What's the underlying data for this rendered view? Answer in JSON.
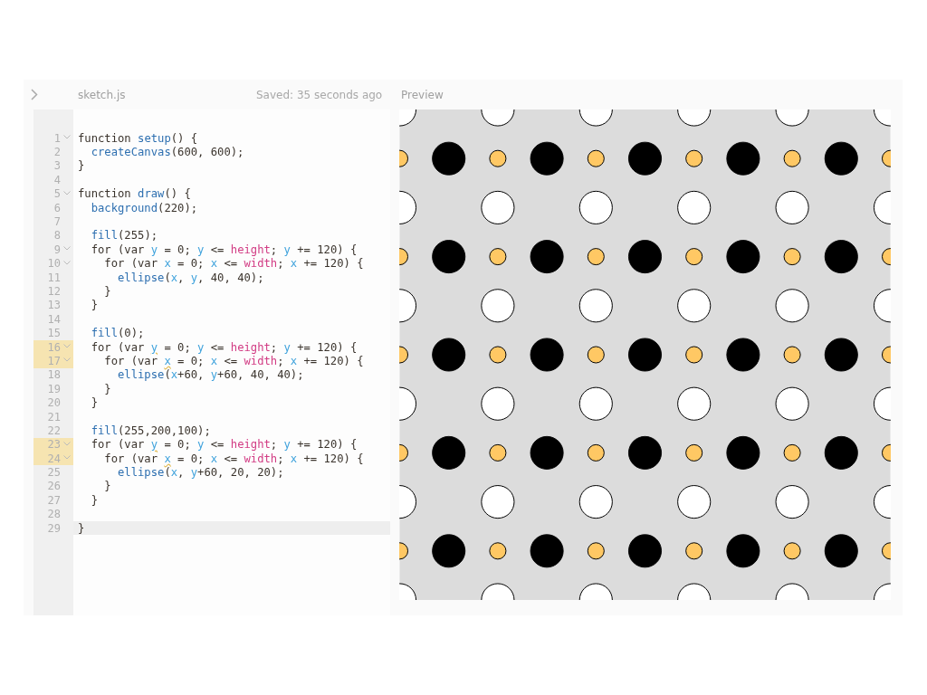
{
  "header": {
    "filename": "sketch.js",
    "save_status": "Saved: 35 seconds ago",
    "preview_label": "Preview"
  },
  "editor": {
    "lines": [
      {
        "number": "1",
        "foldable": true,
        "marked": false,
        "active": false,
        "tokens": [
          {
            "text": "function ",
            "kind": "plain"
          },
          {
            "text": "setup",
            "kind": "func"
          },
          {
            "text": "() {",
            "kind": "plain"
          }
        ]
      },
      {
        "number": "2",
        "foldable": false,
        "marked": false,
        "active": false,
        "tokens": [
          {
            "text": "  createCanvas",
            "kind": "func"
          },
          {
            "text": "(600, 600);",
            "kind": "plain"
          }
        ]
      },
      {
        "number": "3",
        "foldable": false,
        "marked": false,
        "active": false,
        "tokens": [
          {
            "text": "}",
            "kind": "plain"
          }
        ]
      },
      {
        "number": "4",
        "foldable": false,
        "marked": false,
        "active": false
      },
      {
        "number": "5",
        "foldable": true,
        "marked": false,
        "active": false,
        "tokens": [
          {
            "text": "function ",
            "kind": "plain"
          },
          {
            "text": "draw",
            "kind": "func"
          },
          {
            "text": "() {",
            "kind": "plain"
          }
        ]
      },
      {
        "number": "6",
        "foldable": false,
        "marked": false,
        "active": false,
        "tokens": [
          {
            "text": "  background",
            "kind": "func"
          },
          {
            "text": "(220);",
            "kind": "plain"
          }
        ]
      },
      {
        "number": "7",
        "foldable": false,
        "marked": false,
        "active": false
      },
      {
        "number": "8",
        "foldable": false,
        "marked": false,
        "active": false,
        "tokens": [
          {
            "text": "  fill",
            "kind": "func"
          },
          {
            "text": "(255);",
            "kind": "plain"
          }
        ]
      },
      {
        "number": "9",
        "foldable": true,
        "marked": false,
        "active": false,
        "tokens": [
          {
            "text": "  for (var ",
            "kind": "plain"
          },
          {
            "text": "y",
            "kind": "var"
          },
          {
            "text": " = 0; ",
            "kind": "plain"
          },
          {
            "text": "y",
            "kind": "var"
          },
          {
            "text": " <= ",
            "kind": "plain"
          },
          {
            "text": "height",
            "kind": "builtin"
          },
          {
            "text": "; ",
            "kind": "plain"
          },
          {
            "text": "y",
            "kind": "var"
          },
          {
            "text": " += 120) {",
            "kind": "plain"
          }
        ]
      },
      {
        "number": "10",
        "foldable": true,
        "marked": false,
        "active": false,
        "tokens": [
          {
            "text": "    for (var ",
            "kind": "plain"
          },
          {
            "text": "x",
            "kind": "var"
          },
          {
            "text": " = 0; ",
            "kind": "plain"
          },
          {
            "text": "x",
            "kind": "var"
          },
          {
            "text": " <= ",
            "kind": "plain"
          },
          {
            "text": "width",
            "kind": "builtin"
          },
          {
            "text": "; ",
            "kind": "plain"
          },
          {
            "text": "x",
            "kind": "var"
          },
          {
            "text": " += 120) {",
            "kind": "plain"
          }
        ]
      },
      {
        "number": "11",
        "foldable": false,
        "marked": false,
        "active": false,
        "tokens": [
          {
            "text": "      ellipse",
            "kind": "func"
          },
          {
            "text": "(",
            "kind": "plain"
          },
          {
            "text": "x",
            "kind": "var"
          },
          {
            "text": ", ",
            "kind": "plain"
          },
          {
            "text": "y",
            "kind": "var"
          },
          {
            "text": ", 40, 40);",
            "kind": "plain"
          }
        ]
      },
      {
        "number": "12",
        "foldable": false,
        "marked": false,
        "active": false,
        "tokens": [
          {
            "text": "    }",
            "kind": "plain"
          }
        ]
      },
      {
        "number": "13",
        "foldable": false,
        "marked": false,
        "active": false,
        "tokens": [
          {
            "text": "  }",
            "kind": "plain"
          }
        ]
      },
      {
        "number": "14",
        "foldable": false,
        "marked": false,
        "active": false
      },
      {
        "number": "15",
        "foldable": false,
        "marked": false,
        "active": false,
        "tokens": [
          {
            "text": "  fill",
            "kind": "func"
          },
          {
            "text": "(0);",
            "kind": "plain"
          }
        ]
      },
      {
        "number": "16",
        "foldable": true,
        "marked": true,
        "active": false,
        "tokens": [
          {
            "text": "  for (var ",
            "kind": "plain"
          },
          {
            "text": "y",
            "kind": "warn"
          },
          {
            "text": " = 0; ",
            "kind": "plain"
          },
          {
            "text": "y",
            "kind": "var"
          },
          {
            "text": " <= ",
            "kind": "plain"
          },
          {
            "text": "height",
            "kind": "builtin"
          },
          {
            "text": "; ",
            "kind": "plain"
          },
          {
            "text": "y",
            "kind": "var"
          },
          {
            "text": " += 120) {",
            "kind": "plain"
          }
        ]
      },
      {
        "number": "17",
        "foldable": true,
        "marked": true,
        "active": false,
        "tokens": [
          {
            "text": "    for (var ",
            "kind": "plain"
          },
          {
            "text": "x",
            "kind": "warn"
          },
          {
            "text": " = 0; ",
            "kind": "plain"
          },
          {
            "text": "x",
            "kind": "var"
          },
          {
            "text": " <= ",
            "kind": "plain"
          },
          {
            "text": "width",
            "kind": "builtin"
          },
          {
            "text": "; ",
            "kind": "plain"
          },
          {
            "text": "x",
            "kind": "var"
          },
          {
            "text": " += 120) {",
            "kind": "plain"
          }
        ]
      },
      {
        "number": "18",
        "foldable": false,
        "marked": false,
        "active": false,
        "tokens": [
          {
            "text": "      ellipse",
            "kind": "func"
          },
          {
            "text": "(",
            "kind": "plain"
          },
          {
            "text": "x",
            "kind": "var"
          },
          {
            "text": "+60, ",
            "kind": "plain"
          },
          {
            "text": "y",
            "kind": "var"
          },
          {
            "text": "+60, 40, 40);",
            "kind": "plain"
          }
        ]
      },
      {
        "number": "19",
        "foldable": false,
        "marked": false,
        "active": false,
        "tokens": [
          {
            "text": "    }",
            "kind": "plain"
          }
        ]
      },
      {
        "number": "20",
        "foldable": false,
        "marked": false,
        "active": false,
        "tokens": [
          {
            "text": "  }",
            "kind": "plain"
          }
        ]
      },
      {
        "number": "21",
        "foldable": false,
        "marked": false,
        "active": false
      },
      {
        "number": "22",
        "foldable": false,
        "marked": false,
        "active": false,
        "tokens": [
          {
            "text": "  fill",
            "kind": "func"
          },
          {
            "text": "(255,200,100);",
            "kind": "plain"
          }
        ]
      },
      {
        "number": "23",
        "foldable": true,
        "marked": true,
        "active": false,
        "tokens": [
          {
            "text": "  for (var ",
            "kind": "plain"
          },
          {
            "text": "y",
            "kind": "warn"
          },
          {
            "text": " = 0; ",
            "kind": "plain"
          },
          {
            "text": "y",
            "kind": "var"
          },
          {
            "text": " <= ",
            "kind": "plain"
          },
          {
            "text": "height",
            "kind": "builtin"
          },
          {
            "text": "; ",
            "kind": "plain"
          },
          {
            "text": "y",
            "kind": "var"
          },
          {
            "text": " += 120) {",
            "kind": "plain"
          }
        ]
      },
      {
        "number": "24",
        "foldable": true,
        "marked": true,
        "active": false,
        "tokens": [
          {
            "text": "    for (var ",
            "kind": "plain"
          },
          {
            "text": "x",
            "kind": "warn"
          },
          {
            "text": " = 0; ",
            "kind": "plain"
          },
          {
            "text": "x",
            "kind": "var"
          },
          {
            "text": " <= ",
            "kind": "plain"
          },
          {
            "text": "width",
            "kind": "builtin"
          },
          {
            "text": "; ",
            "kind": "plain"
          },
          {
            "text": "x",
            "kind": "var"
          },
          {
            "text": " += 120) {",
            "kind": "plain"
          }
        ]
      },
      {
        "number": "25",
        "foldable": false,
        "marked": false,
        "active": false,
        "tokens": [
          {
            "text": "      ellipse",
            "kind": "func"
          },
          {
            "text": "(",
            "kind": "plain"
          },
          {
            "text": "x",
            "kind": "var"
          },
          {
            "text": ", ",
            "kind": "plain"
          },
          {
            "text": "y",
            "kind": "var"
          },
          {
            "text": "+60, 20, 20);",
            "kind": "plain"
          }
        ]
      },
      {
        "number": "26",
        "foldable": false,
        "marked": false,
        "active": false,
        "tokens": [
          {
            "text": "    }",
            "kind": "plain"
          }
        ]
      },
      {
        "number": "27",
        "foldable": false,
        "marked": false,
        "active": false,
        "tokens": [
          {
            "text": "  }",
            "kind": "plain"
          }
        ]
      },
      {
        "number": "28",
        "foldable": false,
        "marked": false,
        "active": false
      },
      {
        "number": "29",
        "foldable": false,
        "marked": false,
        "active": true,
        "tokens": [
          {
            "text": "}",
            "kind": "plain"
          }
        ]
      }
    ]
  }
}
